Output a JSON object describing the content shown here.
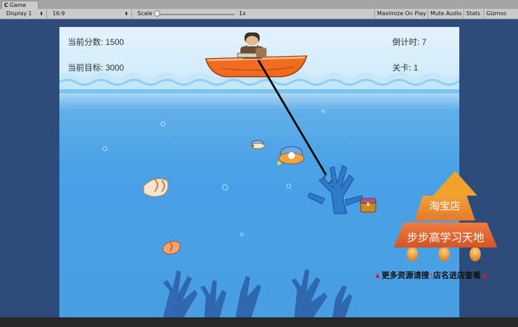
{
  "window": {
    "tab_label": "Game",
    "tab_icon": "C"
  },
  "toolbar": {
    "display_label": "Display 1",
    "aspect_label": "16:9",
    "scale_label": "Scale",
    "scale_value": "1x",
    "maximize_label": "Maximize On Play",
    "mute_label": "Mute Audio",
    "stats_label": "Stats",
    "gizmos_label": "Gizmos"
  },
  "hud": {
    "score_label": "当前分数:",
    "score_value": "1500",
    "target_label": "当前目标:",
    "target_value": "3000",
    "countdown_label": "倒计时:",
    "countdown_value": "7",
    "level_label": "关卡:",
    "level_value": "1"
  },
  "promo": {
    "shop_label": "淘宝店",
    "arrow": "↓",
    "store_name": "步步高学习天地",
    "tagline_prefix": "▲",
    "tagline_1": "更多资源请搜",
    "tagline_mark": "↑",
    "tagline_2": "店名进店查看",
    "tagline_suffix": "▲"
  },
  "colors": {
    "sea": "#4a9ee4",
    "sky": "#e3f3fd",
    "boat": "#f06b1f",
    "coral": "#2e6fc3",
    "promo_orange": "#e47a2a"
  }
}
